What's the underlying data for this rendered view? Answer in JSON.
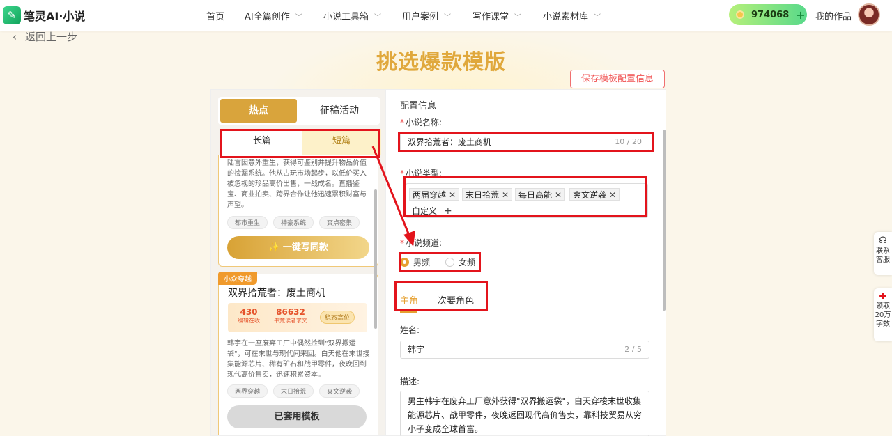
{
  "header": {
    "logo_text": "笔灵AI·小说",
    "nav": [
      {
        "label": "首页",
        "has_menu": false
      },
      {
        "label": "AI全篇创作",
        "has_menu": true
      },
      {
        "label": "小说工具箱",
        "has_menu": true
      },
      {
        "label": "用户案例",
        "has_menu": true
      },
      {
        "label": "写作课堂",
        "has_menu": true
      },
      {
        "label": "小说素材库",
        "has_menu": true
      }
    ],
    "points": "974068",
    "my_works": "我的作品"
  },
  "back_label": "返回上一步",
  "page_title": "挑选爆款模版",
  "save_button": "保存模板配置信息",
  "left": {
    "main_tabs": [
      "热点",
      "征稿活动"
    ],
    "sub_tabs": [
      "长篇",
      "短篇"
    ],
    "card1": {
      "desc": "陆言因意外重生，获得可鉴别并提升物品价值的捡漏系统。他从古玩市场起步，以低价买入被忽视的珍品高价出售，一战成名。直播鉴宝、商业拍卖、跨界合作让他迅速累积财富与声望。",
      "tags": [
        "都市重生",
        "神豪系统",
        "爽点密集"
      ],
      "button": "✨ 一键写同款"
    },
    "card2": {
      "ribbon": "小众穿越",
      "title": "双界拾荒者：废土商机",
      "stat1_num": "430",
      "stat1_label": "编辑在收",
      "stat2_num": "86632",
      "stat2_label": "书荒读者求文",
      "badge": "稳态高位",
      "desc": "韩宇在一座废弃工厂中偶然捡到\"双界搬运袋\"，可在末世与现代间来回。白天他在末世搜集能源芯片、稀有矿石和战甲零件，夜晚回到现代高价售卖，迅速积累资本。",
      "tags": [
        "两界穿越",
        "末日拾荒",
        "爽文逆袭"
      ],
      "button": "已套用模板"
    }
  },
  "right": {
    "config_title": "配置信息",
    "name_label": "小说名称:",
    "name_value": "双界拾荒者：废土商机",
    "name_counter": "10 / 20",
    "type_label": "小说类型:",
    "types": [
      "两届穿越",
      "末日拾荒",
      "每日高能",
      "爽文逆袭"
    ],
    "custom_label": "自定义",
    "channel_label": "小说频道:",
    "channels": [
      "男频",
      "女频"
    ],
    "role_tabs": [
      "主角",
      "次要角色"
    ],
    "person_name_label": "姓名:",
    "person_name_value": "韩宇",
    "person_name_counter": "2 / 5",
    "desc_label": "描述:",
    "desc_value": "男主韩宇在废弃工厂意外获得\"双界搬运袋\"，白天穿梭末世收集能源芯片、战甲零件，夜晚返回现代高价售卖，靠科技贸易从穷小子变成全球首富。"
  },
  "side": {
    "contact": "联系客服",
    "gift_l1": "领取",
    "gift_l2": "20万",
    "gift_l3": "字数"
  }
}
